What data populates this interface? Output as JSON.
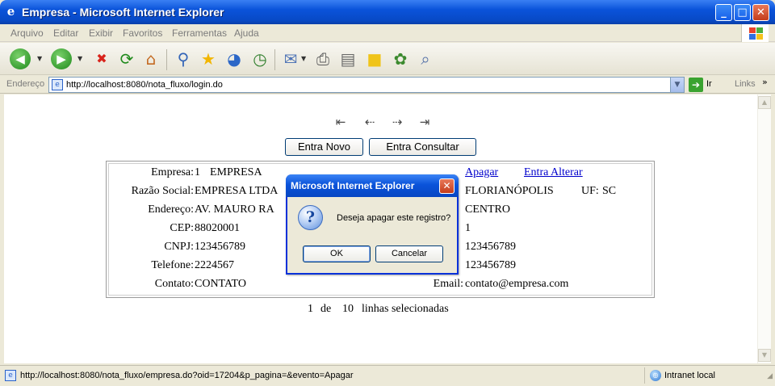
{
  "window": {
    "title": "Empresa - Microsoft Internet Explorer",
    "icon": "ie-icon",
    "controls": {
      "minimize": "_",
      "maximize": "□",
      "close": "✕"
    }
  },
  "menu": [
    "Arquivo",
    "Editar",
    "Exibir",
    "Favoritos",
    "Ferramentas",
    "Ajuda"
  ],
  "toolbar": {
    "icons": [
      "back-icon",
      "forward-icon",
      "stop-icon",
      "refresh-icon",
      "home-icon",
      "search-icon",
      "favorites-icon",
      "media-icon",
      "history-icon",
      "mail-icon",
      "print-icon",
      "edit-icon",
      "discuss-icon",
      "messenger-icon",
      "research-icon"
    ]
  },
  "address": {
    "label": "Endereço",
    "url": "http://localhost:8080/nota_fluxo/login.do",
    "go_label": "Ir",
    "links_label": "Links"
  },
  "page": {
    "nav_arrows": [
      "first-icon",
      "previous-icon",
      "next-icon",
      "last-icon"
    ],
    "buttons": {
      "new": "Entra Novo",
      "query": "Entra Consultar"
    },
    "record": {
      "empresa_label": "Empresa:",
      "empresa_id": "1",
      "empresa_name": "EMPRESA",
      "razao_label": "Razão Social:",
      "razao_value": "EMPRESA LTDA",
      "endereco_label": "Endereço:",
      "endereco_value": "AV. MAURO RA",
      "cep_label": "CEP:",
      "cep_value": "88020001",
      "cnpj_label": "CNPJ:",
      "cnpj_value": "123456789",
      "telefone_label": "Telefone:",
      "telefone_value": "2224567",
      "contato_label": "Contato:",
      "contato_value": "CONTATO",
      "apagar_link": "Apagar",
      "alterar_link": "Entra Alterar",
      "cidade_value": "FLORIANÓPOLIS",
      "uf_label": "UF:",
      "uf_value": "SC",
      "bairro_value": "CENTRO",
      "numero_value": "1",
      "ie_value": "123456789",
      "fax_value": "123456789",
      "email_label": "Email:",
      "email_value": "contato@empresa.com"
    },
    "pagination": {
      "current": "1",
      "of": "de",
      "total": "10",
      "suffix": "linhas selecionadas"
    }
  },
  "dialog": {
    "title": "Microsoft Internet Explorer",
    "icon": "question-icon",
    "message": "Deseja apagar este registro?",
    "ok_label": "OK",
    "cancel_label": "Cancelar"
  },
  "status": {
    "text": "http://localhost:8080/nota_fluxo/empresa.do?oid=17204&p_pagina=&evento=Apagar",
    "zone": "Intranet local"
  }
}
